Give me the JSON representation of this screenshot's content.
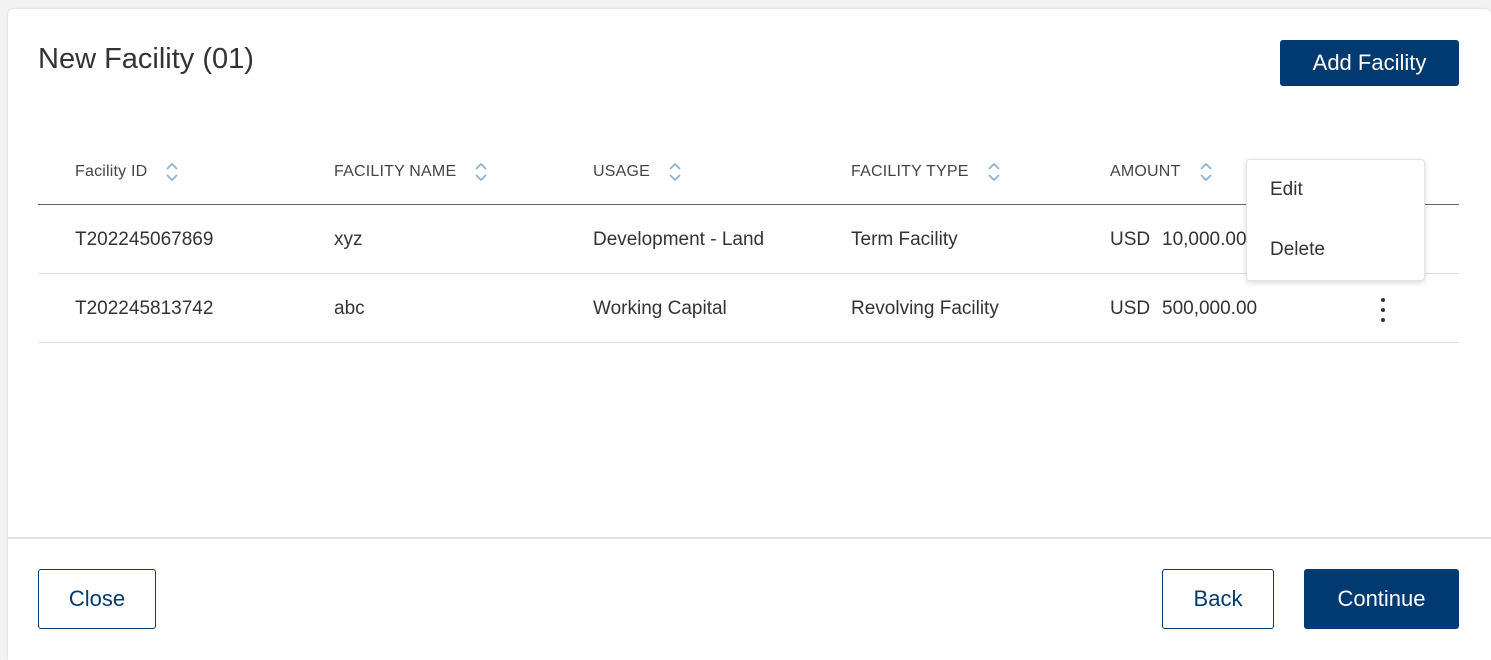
{
  "header": {
    "title": "New Facility (01)",
    "add_button_label": "Add Facility"
  },
  "table": {
    "columns": [
      "Facility ID",
      "FACILITY NAME",
      "USAGE",
      "FACILITY TYPE",
      "AMOUNT"
    ],
    "rows": [
      {
        "facility_id": "T202245067869",
        "facility_name": "xyz",
        "usage": "Development - Land",
        "facility_type": "Term Facility",
        "currency": "USD",
        "amount": "10,000.00"
      },
      {
        "facility_id": "T202245813742",
        "facility_name": "abc",
        "usage": "Working Capital",
        "facility_type": "Revolving Facility",
        "currency": "USD",
        "amount": "500,000.00"
      }
    ]
  },
  "context_menu": {
    "items": [
      "Edit",
      "Delete"
    ]
  },
  "footer": {
    "close_label": "Close",
    "back_label": "Back",
    "continue_label": "Continue"
  },
  "colors": {
    "primary": "#003a70",
    "sort_icon": "#8fb2d3"
  },
  "icons": {
    "sort": "sort-icon",
    "more": "kebab-menu-icon"
  }
}
